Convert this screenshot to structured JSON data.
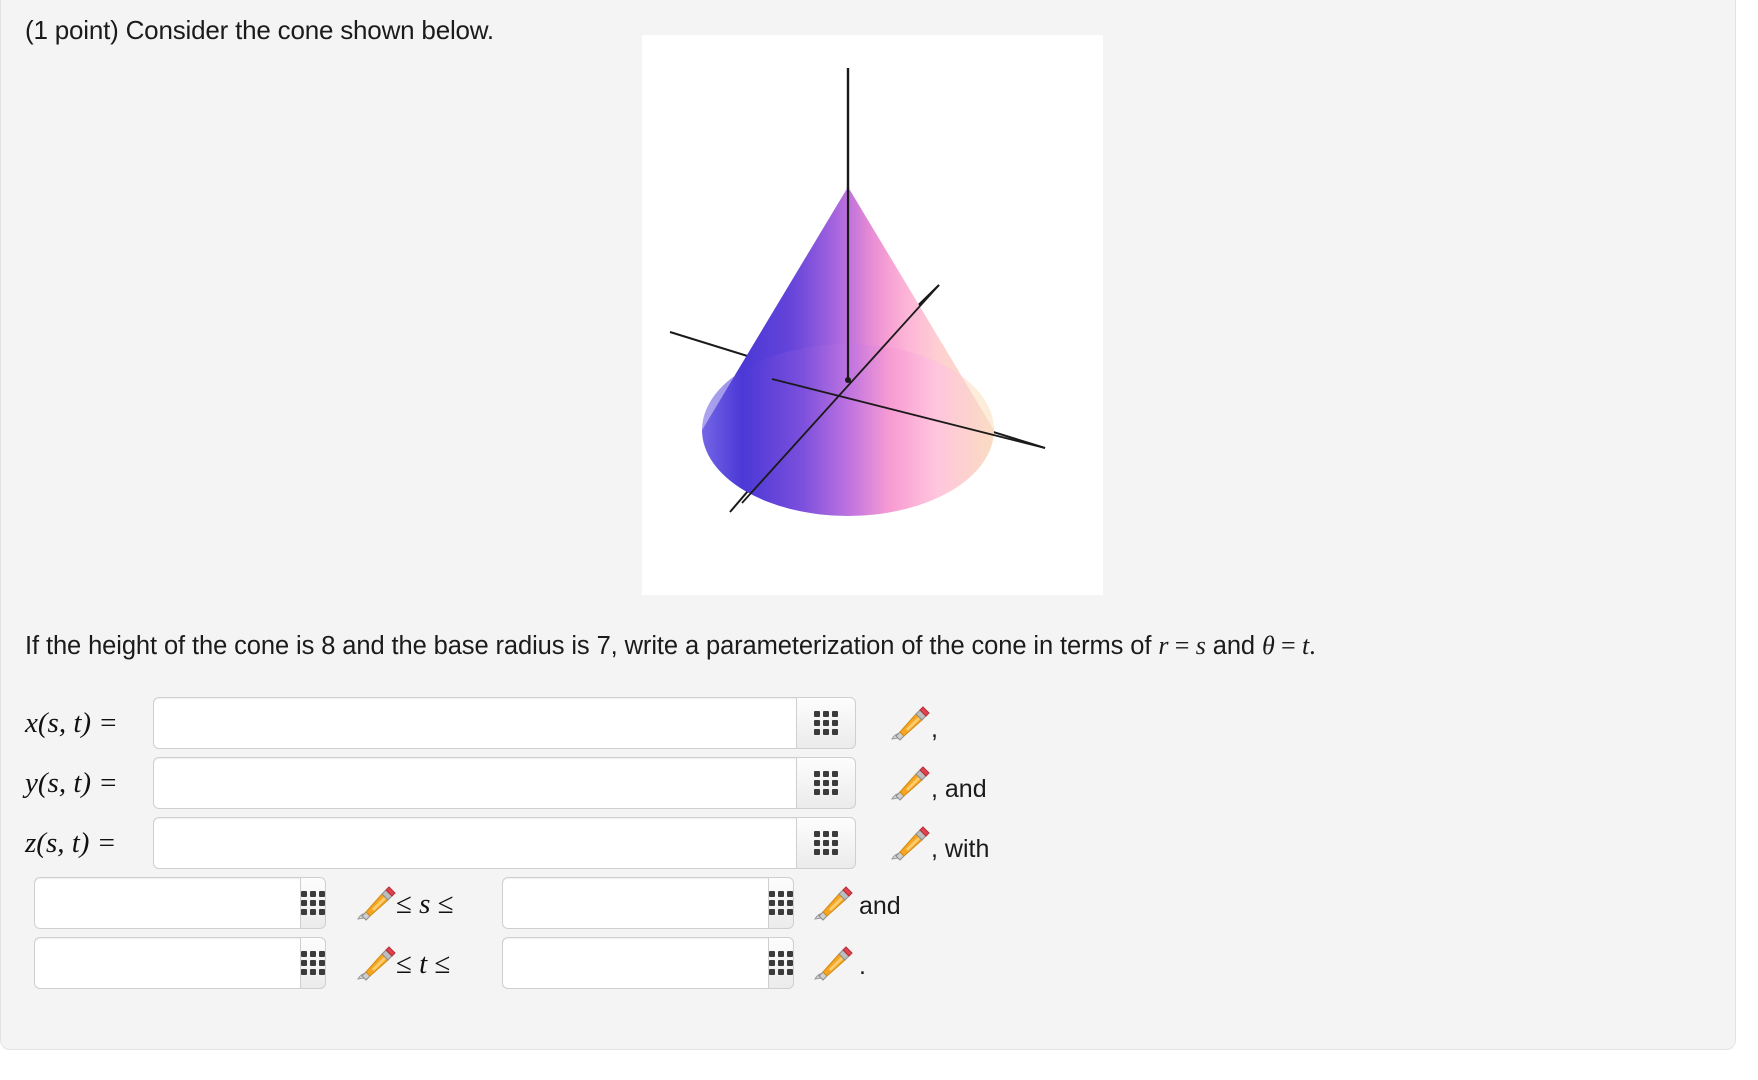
{
  "prompt": "(1 point) Consider the cone shown below.",
  "figure": {
    "name": "cone-figure",
    "description": "Inverted cone with apex at top, circular base opening downward, shaded with a blue-to-pink-to-peach gradient, drawn over three coordinate axes",
    "colors": {
      "left": "#3d2fd4",
      "mid_purple": "#a860e0",
      "pink": "#ff9fd8",
      "peach": "#fbe0bd",
      "axis": "#1a1a1a",
      "panel_bg": "#ffffff"
    }
  },
  "question": {
    "part1": "If the height of the cone is 8 and the base radius is 7, write a parameterization of the cone in terms of ",
    "r": "r",
    "eq1": " = ",
    "s": "s",
    "mid": " and ",
    "theta": "θ",
    "eq2": " = ",
    "t": "t",
    "period": "."
  },
  "answers": {
    "rows": [
      {
        "label": "x(s, t) =",
        "value": "",
        "tail": ","
      },
      {
        "label": "y(s, t) =",
        "value": "",
        "tail": ", and"
      },
      {
        "label": "z(s, t) =",
        "value": "",
        "tail": ", with"
      }
    ],
    "ranges": [
      {
        "lower": "",
        "upper": "",
        "var": "s",
        "op_left": "≤",
        "op_right": "≤",
        "tail": "and"
      },
      {
        "lower": "",
        "upper": "",
        "var": "t",
        "op_left": "≤",
        "op_right": "≤",
        "tail": "."
      }
    ],
    "input_placeholder": "",
    "keypad_icon": "grid-keypad-icon",
    "pencil_icon": "pencil-edit-icon"
  }
}
